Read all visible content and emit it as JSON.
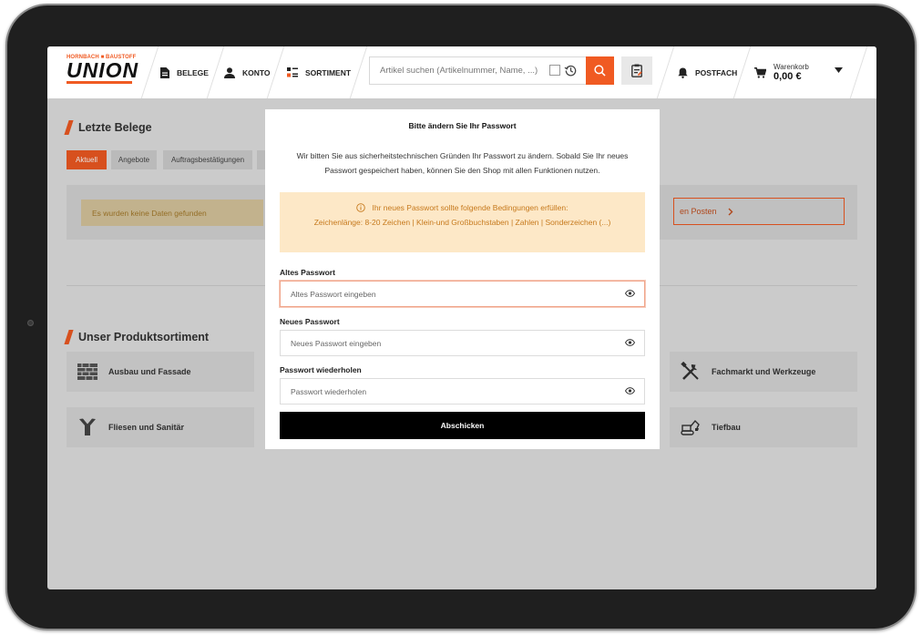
{
  "colors": {
    "accent": "#f05a22",
    "info_bg": "#fde8c7",
    "info_text": "#c6791c",
    "submit_bg": "#000000"
  },
  "logo": {
    "top_text": "HORNBACH ■ BAUSTOFF",
    "main_text": "UNION"
  },
  "nav": {
    "belege": "BELEGE",
    "konto": "KONTO",
    "sortiment": "SORTIMENT",
    "postfach": "POSTFACH",
    "cart_label": "Warenkorb",
    "cart_total": "0,00 €"
  },
  "search": {
    "placeholder": "Artikel suchen (Artikelnummer, Name, ...)"
  },
  "recent": {
    "title": "Letzte Belege",
    "tabs": [
      {
        "label": "Aktuell",
        "active": true
      },
      {
        "label": "Angebote",
        "active": false
      },
      {
        "label": "Auftragsbestätigungen",
        "active": false
      }
    ],
    "empty_text": "Es wurden keine Daten gefunden",
    "posten_text": "en Posten"
  },
  "assortment": {
    "title": "Unser Produktsortiment",
    "items": [
      {
        "label": "Ausbau und Fassade",
        "icon": "wall-icon"
      },
      {
        "label": "Fliesen und Sanitär",
        "icon": "pipe-icon"
      },
      {
        "label": "Fachmarkt und Werkzeuge",
        "icon": "tools-icon"
      },
      {
        "label": "Tiefbau",
        "icon": "excavator-icon"
      }
    ]
  },
  "modal": {
    "title": "Bitte ändern Sie Ihr Passwort",
    "text_line1": "Wir bitten Sie aus sicherheitstechnischen Gründen Ihr Passwort zu ändern. Sobald Sie Ihr neues",
    "text_line2": "Passwort gespeichert haben, können Sie den Shop mit allen Funktionen nutzen.",
    "info_line1": "Ihr neues Passwort sollte folgende Bedingungen erfüllen:",
    "info_line2": "Zeichenlänge: 8-20 Zeichen | Klein-und Großbuchstaben | Zahlen | Sonderzeichen (...)",
    "fields": [
      {
        "label": "Altes Passwort",
        "placeholder": "Altes Passwort eingeben",
        "focused": true
      },
      {
        "label": "Neues Passwort",
        "placeholder": "Neues Passwort eingeben",
        "focused": false
      },
      {
        "label": "Passwort wiederholen",
        "placeholder": "Passwort wiederholen",
        "focused": false
      }
    ],
    "submit_label": "Abschicken"
  }
}
